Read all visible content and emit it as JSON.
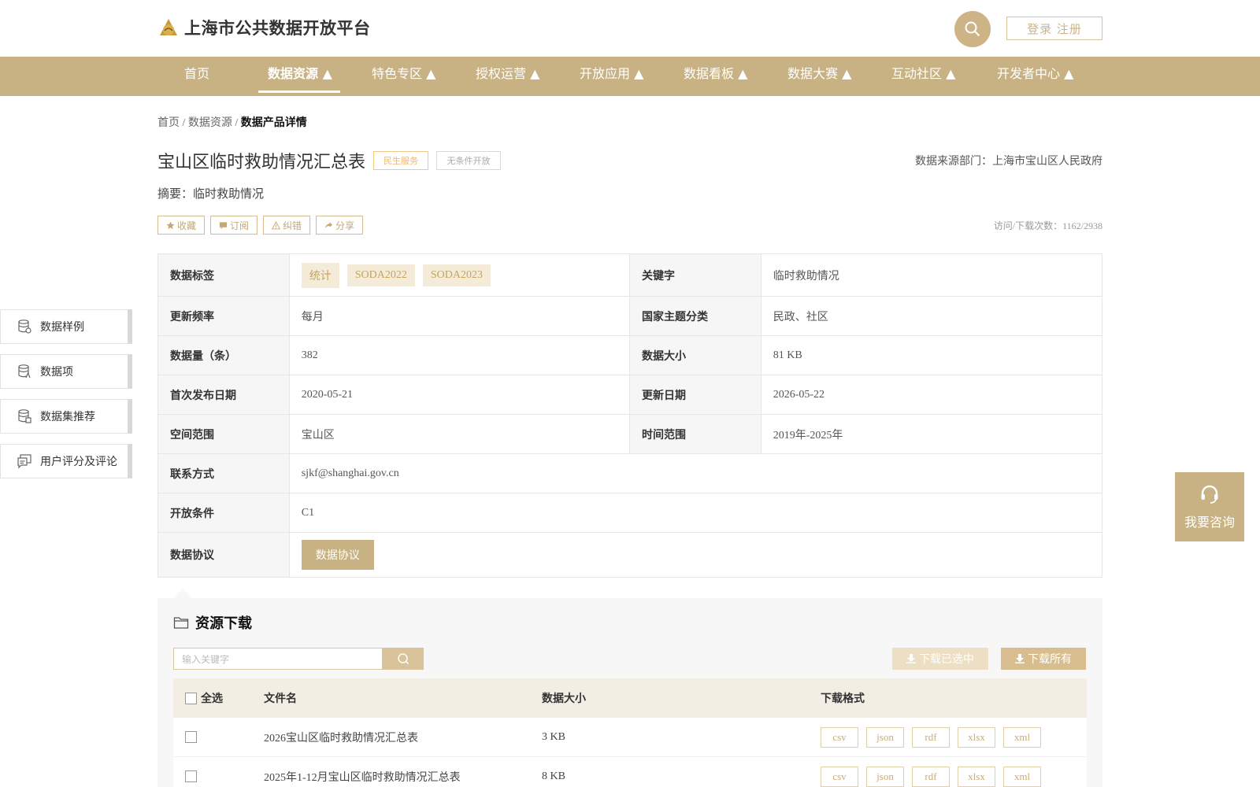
{
  "header": {
    "site_title": "上海市公共数据开放平台",
    "login_label": "登录 注册"
  },
  "nav": {
    "items": [
      {
        "label": "首页"
      },
      {
        "label": "数据资源 ▲"
      },
      {
        "label": "特色专区 ▲"
      },
      {
        "label": "授权运营 ▲"
      },
      {
        "label": "开放应用 ▲"
      },
      {
        "label": "数据看板 ▲"
      },
      {
        "label": "数据大赛 ▲"
      },
      {
        "label": "互动社区 ▲"
      },
      {
        "label": "开发者中心 ▲"
      }
    ],
    "active_index": 1
  },
  "breadcrumb": {
    "home": "首页",
    "sep": "/",
    "level2": "数据资源",
    "current": "数据产品详情"
  },
  "dataset": {
    "title": "宝山区临时救助情况汇总表",
    "tag_service": "民生服务",
    "tag_open": "无条件开放",
    "source": "数据来源部门：上海市宝山区人民政府",
    "summary": "摘要：临时救助情况",
    "visits": "访问/下载次数：1162/2938"
  },
  "actions": {
    "collect": "收藏",
    "subscribe": "订阅",
    "report": "纠错",
    "share": "分享"
  },
  "info": {
    "labels_label": "数据标签",
    "tags": [
      "统计",
      "SODA2022",
      "SODA2023"
    ],
    "keyword_label": "关键字",
    "keyword": "临时救助情况",
    "freq_label": "更新频率",
    "freq": "每月",
    "theme_label": "国家主题分类",
    "theme": "民政、社区",
    "count_label": "数据量（条）",
    "count": "382",
    "size_label": "数据大小",
    "size": "81 KB",
    "pub_label": "首次发布日期",
    "pub": "2020-05-21",
    "upd_label": "更新日期",
    "upd": "2026-05-22",
    "space_label": "空间范围",
    "space": "宝山区",
    "time_label": "时间范围",
    "time": "2019年-2025年",
    "contact_label": "联系方式",
    "contact": "sjkf@shanghai.gov.cn",
    "cond_label": "开放条件",
    "cond": "C1",
    "agree_label": "数据协议",
    "agree_btn": "数据协议"
  },
  "side_menu": [
    {
      "label": "数据样例",
      "icon": "database-sample-icon"
    },
    {
      "label": "数据项",
      "icon": "database-item-icon"
    },
    {
      "label": "数据集推荐",
      "icon": "database-recommend-icon"
    },
    {
      "label": "用户评分及评论",
      "icon": "comment-icon"
    }
  ],
  "consult": {
    "label": "我要咨询"
  },
  "download": {
    "title": "资源下载",
    "search_placeholder": "输入关键字",
    "download_selected": "下载已选中",
    "download_all": "下载所有",
    "headers": {
      "select_all": "全选",
      "filename": "文件名",
      "size": "数据大小",
      "format": "下载格式"
    },
    "files": [
      {
        "name": "2026宝山区临时救助情况汇总表",
        "size": "3 KB",
        "formats": [
          "csv",
          "json",
          "rdf",
          "xlsx",
          "xml"
        ]
      },
      {
        "name": "2025年1-12月宝山区临时救助情况汇总表",
        "size": "8 KB",
        "formats": [
          "csv",
          "json",
          "rdf",
          "xlsx",
          "xml"
        ]
      }
    ]
  },
  "colors": {
    "brand": "#c8b283",
    "tag_orange": "#f0b86a"
  }
}
